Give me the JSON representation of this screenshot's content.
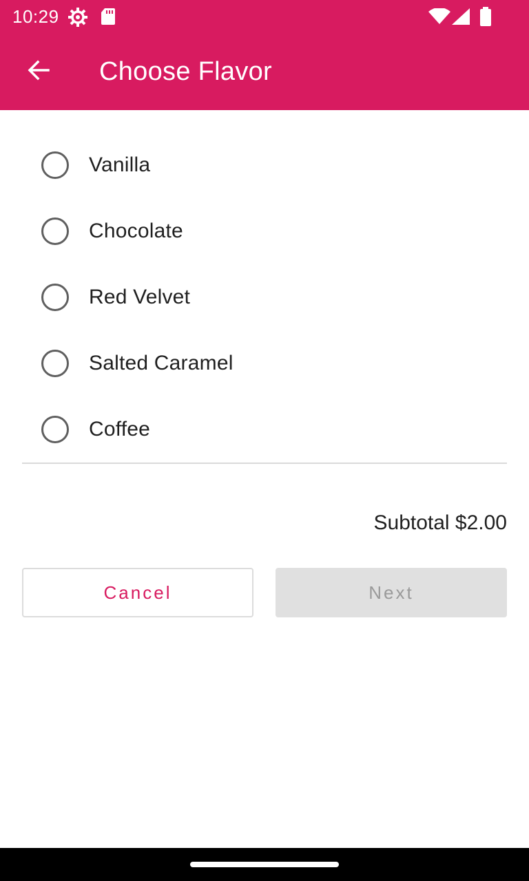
{
  "status_bar": {
    "time": "10:29",
    "icons": [
      "settings-gear-icon",
      "sd-card-icon",
      "wifi-icon",
      "cell-signal-icon",
      "battery-icon"
    ]
  },
  "app_bar": {
    "back_icon": "arrow-back-icon",
    "title": "Choose Flavor"
  },
  "flavors": [
    {
      "label": "Vanilla",
      "selected": false
    },
    {
      "label": "Chocolate",
      "selected": false
    },
    {
      "label": "Red Velvet",
      "selected": false
    },
    {
      "label": "Salted Caramel",
      "selected": false
    },
    {
      "label": "Coffee",
      "selected": false
    }
  ],
  "subtotal": "Subtotal $2.00",
  "buttons": {
    "cancel": "Cancel",
    "next": "Next"
  },
  "colors": {
    "primary": "#d81b60",
    "disabled_bg": "#e0e0e0",
    "disabled_text": "#9a9a9a"
  }
}
